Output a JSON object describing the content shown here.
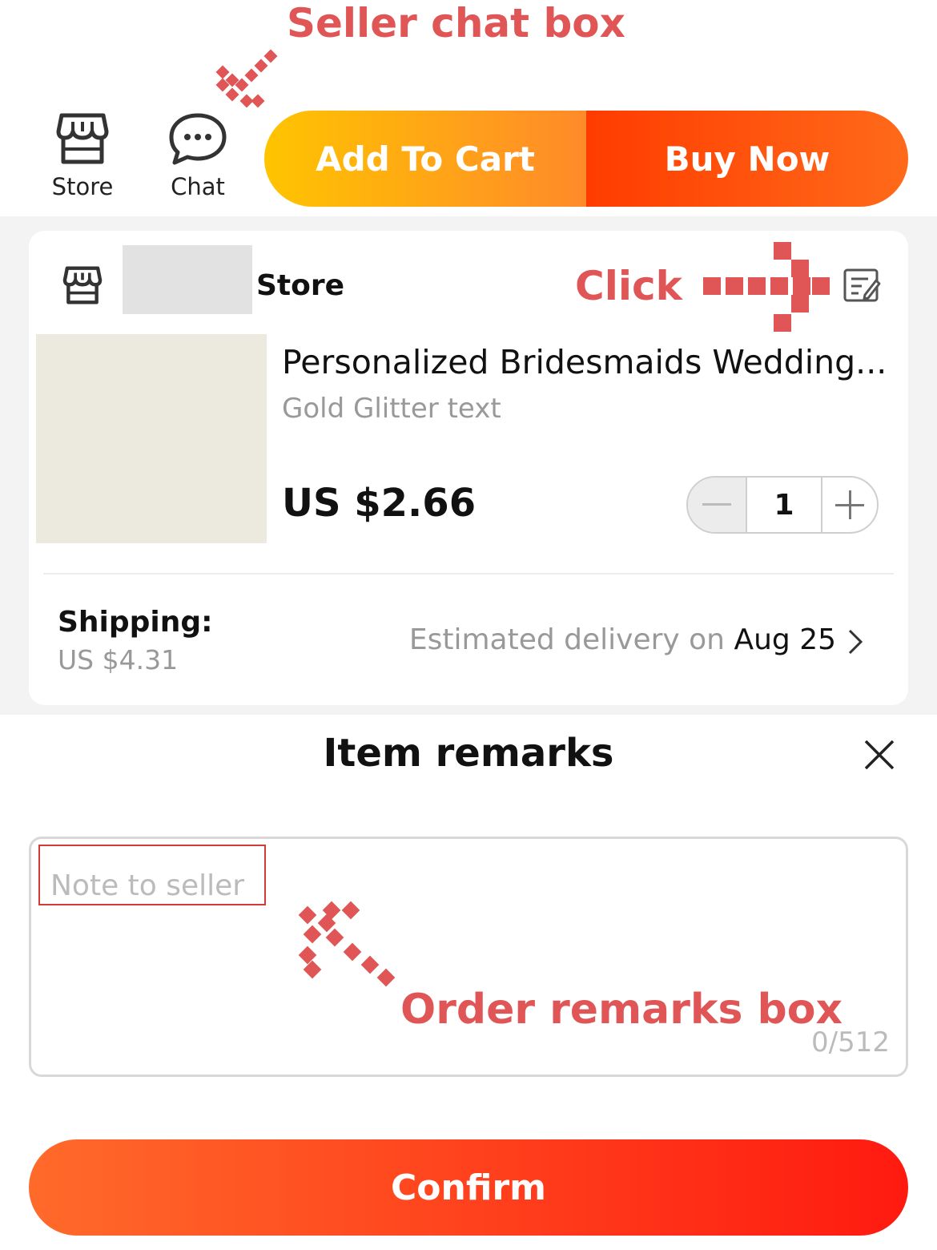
{
  "annotations": {
    "seller_chat": "Seller chat box",
    "click": "Click",
    "order_remarks": "Order remarks box"
  },
  "bottom_bar": {
    "store_label": "Store",
    "chat_label": "Chat",
    "add_to_cart": "Add To Cart",
    "buy_now": "Buy Now"
  },
  "order": {
    "store_name": "Store",
    "product_title": "Personalized Bridesmaids Wedding...",
    "variant": "Gold Glitter text",
    "price": "US $2.66",
    "quantity": "1",
    "shipping_label": "Shipping:",
    "shipping_price": "US $4.31",
    "delivery_prefix": "Estimated delivery on ",
    "delivery_date": "Aug 25"
  },
  "remarks_sheet": {
    "title": "Item remarks",
    "placeholder": "Note to seller",
    "counter": "0/512",
    "confirm": "Confirm"
  },
  "colors": {
    "annotation": "#e05555",
    "cart_gradient": [
      "#ffc400",
      "#ff8a2a"
    ],
    "buy_gradient": [
      "#ff3c00",
      "#ff6a1a"
    ],
    "confirm_gradient": [
      "#ff6a2a",
      "#ff1a10"
    ]
  },
  "icons": [
    "store-icon",
    "chat-icon",
    "edit-note-icon",
    "minus-icon",
    "plus-icon",
    "chevron-right-icon",
    "close-icon"
  ]
}
